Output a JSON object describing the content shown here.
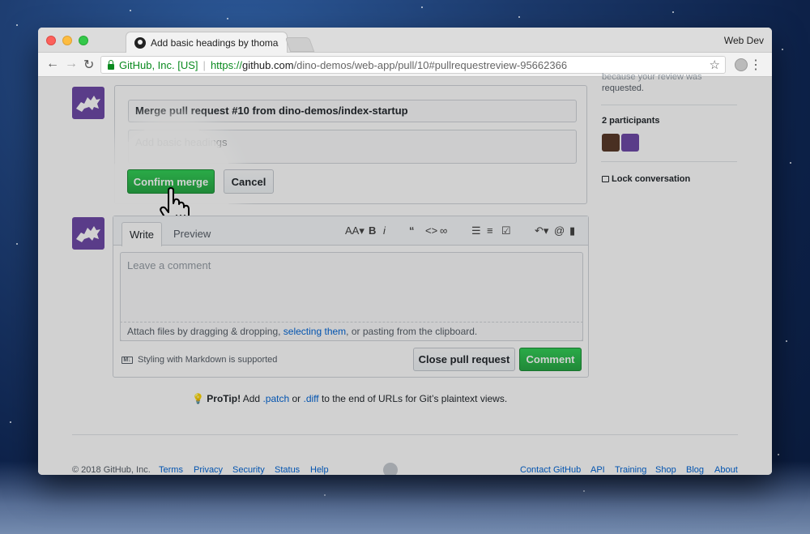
{
  "browser": {
    "tab_title": "Add basic headings by thomas",
    "profile": "Web Dev",
    "url_org": "GitHub, Inc. [US]",
    "url_scheme": "https://",
    "url_host": "github.com",
    "url_path": "/dino-demos/web-app/pull/10#pullrequestreview-95662366"
  },
  "merge": {
    "title": "Merge pull request #10 from dino-demos/index-startup",
    "body": "Add basic headings",
    "confirm_label": "Confirm merge",
    "cancel_label": "Cancel"
  },
  "comment": {
    "tab_write": "Write",
    "tab_preview": "Preview",
    "placeholder": "Leave a comment",
    "attach_prefix": "Attach files by dragging & dropping, ",
    "attach_link": "selecting them",
    "attach_suffix": ", or pasting from the clipboard.",
    "markdown_note": "Styling with Markdown is supported",
    "close_label": "Close pull request",
    "comment_label": "Comment"
  },
  "sidebar": {
    "partial_text_1": "because your review was",
    "partial_text_2": "requested.",
    "participants": "2 participants",
    "lock": "Lock conversation"
  },
  "protip": {
    "label": "ProTip!",
    "text1": " Add ",
    "link1": ".patch",
    "text2": " or ",
    "link2": ".diff",
    "text3": " to the end of URLs for Git’s plaintext views."
  },
  "footer": {
    "copyright": "© 2018 GitHub, Inc.",
    "links_left": [
      "Terms",
      "Privacy",
      "Security",
      "Status",
      "Help"
    ],
    "links_right": [
      "Contact GitHub",
      "API",
      "Training",
      "Shop",
      "Blog",
      "About"
    ]
  },
  "colors": {
    "brand_green": "#28a745",
    "link_blue": "#0366d6",
    "avatar_purple": "#6e4aa8"
  }
}
